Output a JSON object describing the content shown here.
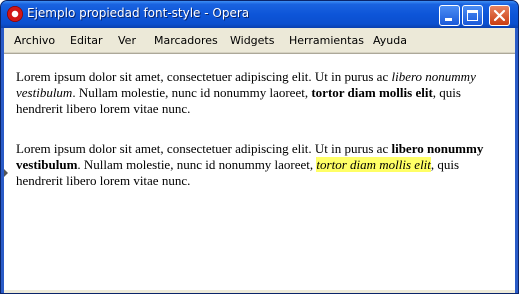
{
  "window": {
    "title": "Ejemplo propiedad font-style - Opera"
  },
  "menu": [
    "Archivo",
    "Editar",
    "Ver",
    "Marcadores",
    "Widgets",
    "Herramientas",
    "Ayuda"
  ],
  "paragraph1": {
    "text1": "Lorem ipsum dolor sit amet, consectetuer adipiscing elit. Ut in purus ac ",
    "italic": "libero nonummy vestibulum",
    "text2": ". Nullam molestie, nunc id nonummy laoreet, ",
    "bold": "tortor diam mollis elit",
    "text3": ", quis hendrerit libero lorem vitae nunc."
  },
  "paragraph2": {
    "text1": "Lorem ipsum dolor sit amet, consectetuer adipiscing elit. Ut in purus ac ",
    "bold": "libero nonummy vestibulum",
    "text2": ". Nullam molestie, nunc id nonummy laoreet, ",
    "highlight": "tortor diam mollis elit",
    "text3": ", quis hendrerit libero lorem vitae nunc."
  },
  "colors": {
    "titlebar": "#0b4fcf",
    "highlight": "#ffff66",
    "menubar": "#ece9d8"
  },
  "icons": {
    "app": "opera-logo-icon",
    "minimize": "minimize-icon",
    "maximize": "maximize-icon",
    "close": "close-icon"
  }
}
